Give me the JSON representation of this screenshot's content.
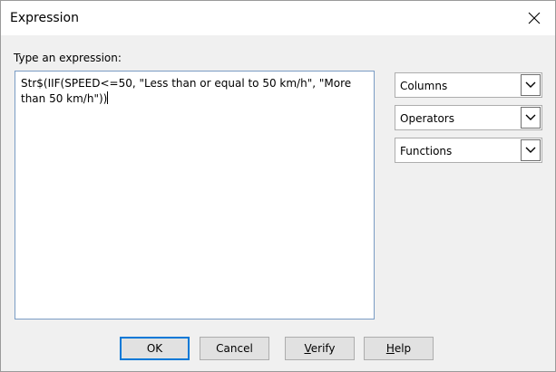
{
  "window": {
    "title": "Expression"
  },
  "prompt": "Type an expression:",
  "expression": "Str$(IIF(SPEED<=50, \"Less than or equal to 50 km/h\", \"More than 50 km/h\"))",
  "dropdowns": [
    {
      "label": "Columns"
    },
    {
      "label": "Operators"
    },
    {
      "label": "Functions"
    }
  ],
  "buttons": {
    "ok": "OK",
    "cancel": "Cancel",
    "verify_mnemonic": "V",
    "verify_rest": "erify",
    "help_mnemonic": "H",
    "help_rest": "elp"
  },
  "icons": {
    "close": "close-icon",
    "dropdown": "chevron-down-icon"
  }
}
